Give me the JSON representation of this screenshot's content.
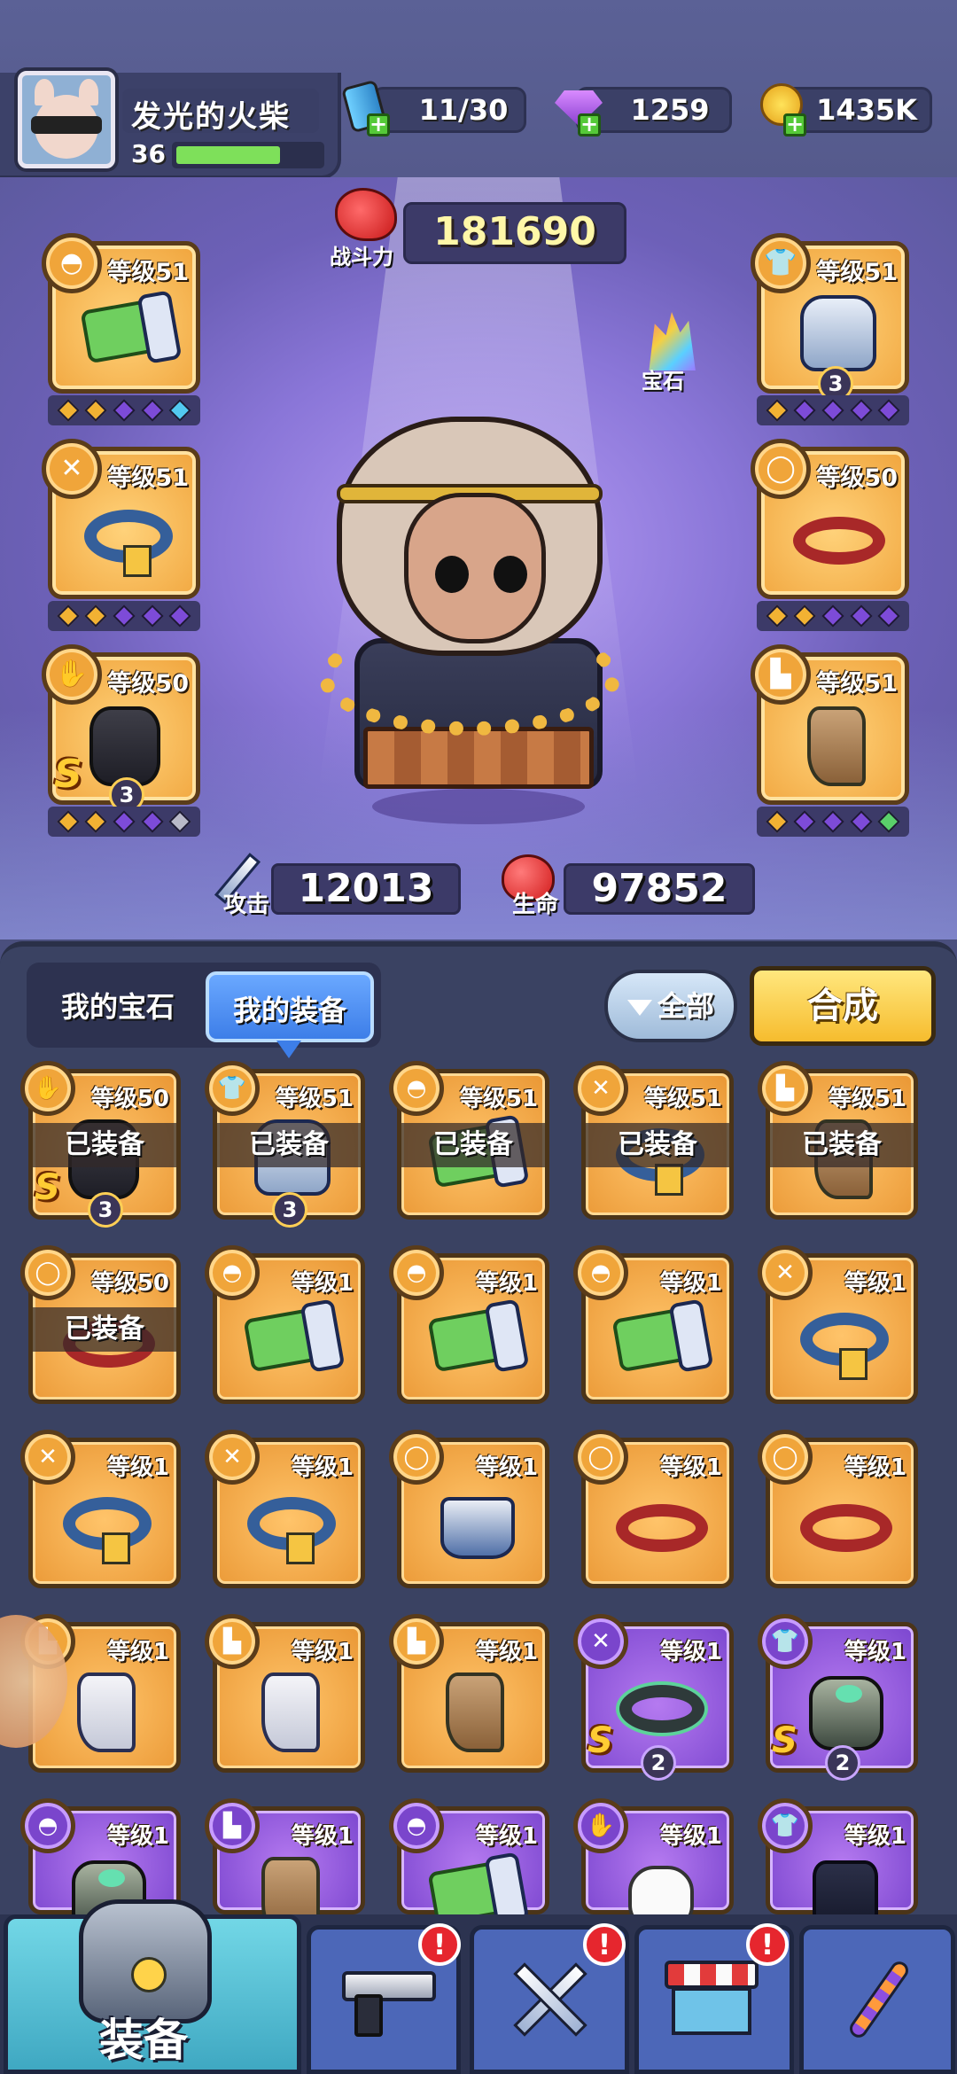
{
  "player": {
    "name": "发光的火柴",
    "level": "36",
    "xp_fraction": 0.72
  },
  "resources": {
    "energy": "11/30",
    "gems": "1259",
    "coins": "1435K"
  },
  "hero": {
    "power_label": "战斗力",
    "power_value": "181690",
    "gem_button_label": "宝石",
    "attack_label": "攻击",
    "attack_value": "12013",
    "hp_label": "生命",
    "hp_value": "97852"
  },
  "equipped_slots": [
    {
      "slot": "hat",
      "type_icon": "hat-icon",
      "level": "等级51",
      "gems": [
        "gold",
        "gold",
        "purple",
        "purple",
        "cyan"
      ]
    },
    {
      "slot": "necklace",
      "type_icon": "necklace-icon",
      "level": "等级51",
      "gems": [
        "gold",
        "gold",
        "purple",
        "purple",
        "purple"
      ]
    },
    {
      "slot": "glove",
      "type_icon": "glove-icon",
      "level": "等级50",
      "rank": "S",
      "stars": "3",
      "gems": [
        "gold",
        "gold",
        "purple",
        "purple",
        "gray"
      ]
    },
    {
      "slot": "armor",
      "type_icon": "shirt-icon",
      "level": "等级51",
      "stars": "3",
      "gems": [
        "gold",
        "purple",
        "purple",
        "purple",
        "purple"
      ]
    },
    {
      "slot": "belt",
      "type_icon": "belt-icon",
      "level": "等级50",
      "gems": [
        "gold",
        "gold",
        "purple",
        "purple",
        "purple"
      ]
    },
    {
      "slot": "boots",
      "type_icon": "boot-icon",
      "level": "等级51",
      "gems": [
        "gold",
        "purple",
        "purple",
        "purple",
        "green"
      ]
    }
  ],
  "inventory": {
    "tab_gems": "我的宝石",
    "tab_equipment": "我的装备",
    "filter_label": "全部",
    "combine_label": "合成",
    "equipped_tag": "已装备",
    "items": [
      {
        "type_icon": "glove-icon",
        "level": "等级50",
        "equipped": true,
        "rank": "S",
        "stars": "3",
        "art": "glove",
        "rarity": "gold"
      },
      {
        "type_icon": "shirt-icon",
        "level": "等级51",
        "equipped": true,
        "stars": "3",
        "art": "armor",
        "rarity": "gold"
      },
      {
        "type_icon": "hat-icon",
        "level": "等级51",
        "equipped": true,
        "art": "bracer",
        "rarity": "gold"
      },
      {
        "type_icon": "necklace-icon",
        "level": "等级51",
        "equipped": true,
        "art": "collar",
        "rarity": "gold"
      },
      {
        "type_icon": "boot-icon",
        "level": "等级51",
        "equipped": true,
        "art": "boot",
        "rarity": "gold"
      },
      {
        "type_icon": "belt-icon",
        "level": "等级50",
        "equipped": true,
        "art": "belt",
        "rarity": "gold"
      },
      {
        "type_icon": "hat-icon",
        "level": "等级1",
        "art": "bracer",
        "rarity": "gold"
      },
      {
        "type_icon": "hat-icon",
        "level": "等级1",
        "art": "bracer",
        "rarity": "gold"
      },
      {
        "type_icon": "hat-icon",
        "level": "等级1",
        "art": "bracer",
        "rarity": "gold"
      },
      {
        "type_icon": "necklace-icon",
        "level": "等级1",
        "art": "collar",
        "rarity": "gold"
      },
      {
        "type_icon": "necklace-icon",
        "level": "等级1",
        "art": "collar",
        "rarity": "gold"
      },
      {
        "type_icon": "necklace-icon",
        "level": "等级1",
        "art": "collar",
        "rarity": "gold"
      },
      {
        "type_icon": "belt-icon",
        "level": "等级1",
        "art": "pants",
        "rarity": "gold"
      },
      {
        "type_icon": "belt-icon",
        "level": "等级1",
        "art": "belt",
        "rarity": "gold"
      },
      {
        "type_icon": "belt-icon",
        "level": "等级1",
        "art": "belt",
        "rarity": "gold"
      },
      {
        "type_icon": "boot-icon",
        "level": "等级1",
        "art": "boot-white",
        "rarity": "gold"
      },
      {
        "type_icon": "boot-icon",
        "level": "等级1",
        "art": "boot-white",
        "rarity": "gold"
      },
      {
        "type_icon": "boot-icon",
        "level": "等级1",
        "art": "boot",
        "rarity": "gold"
      },
      {
        "type_icon": "necklace-icon",
        "level": "等级1",
        "rank": "S",
        "stars": "2",
        "art": "ring",
        "rarity": "purple"
      },
      {
        "type_icon": "shirt-icon",
        "level": "等级1",
        "rank": "S",
        "stars": "2",
        "art": "mech",
        "rarity": "purple"
      },
      {
        "type_icon": "hat-icon",
        "level": "等级1",
        "art": "mech",
        "rarity": "purple"
      },
      {
        "type_icon": "boot-icon",
        "level": "等级1",
        "art": "boot",
        "rarity": "purple"
      },
      {
        "type_icon": "hat-icon",
        "level": "等级1",
        "art": "bracer",
        "rarity": "purple"
      },
      {
        "type_icon": "glove-icon",
        "level": "等级1",
        "art": "fist",
        "rarity": "purple"
      },
      {
        "type_icon": "shirt-icon",
        "level": "等级1",
        "art": "coat",
        "rarity": "purple"
      }
    ]
  },
  "bottom_nav": {
    "equipment_label": "装备",
    "alert_mark": "!",
    "tabs": [
      {
        "icon": "pistol-icon",
        "alert": true
      },
      {
        "icon": "crossed-swords-icon",
        "alert": true
      },
      {
        "icon": "shop-icon",
        "alert": true
      },
      {
        "icon": "dna-icon",
        "alert": false
      }
    ]
  },
  "colors": {
    "gold_slot": "#f0a43c",
    "purple_slot": "#7b46cf",
    "combine_button": "#f6bc2e",
    "active_tab": "#3d7ee8",
    "alert": "#e6262e"
  }
}
